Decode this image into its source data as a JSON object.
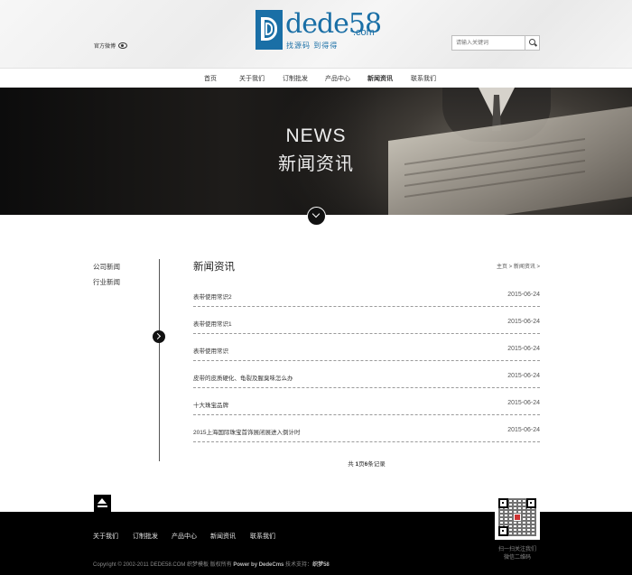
{
  "header": {
    "weibo_label": "官方微博",
    "logo": {
      "text": "dede58",
      "suffix": ".com",
      "slogan": "找源码 到得得"
    },
    "search": {
      "placeholder": "请输入关键词"
    }
  },
  "nav": {
    "items": [
      {
        "label": "首页",
        "active": false
      },
      {
        "label": "关于我们",
        "active": false
      },
      {
        "label": "订制批发",
        "active": false
      },
      {
        "label": "产品中心",
        "active": false
      },
      {
        "label": "新闻资讯",
        "active": true
      },
      {
        "label": "联系我们",
        "active": false
      }
    ]
  },
  "banner": {
    "title_en": "NEWS",
    "title_cn": "新闻资讯"
  },
  "sidebar": {
    "items": [
      "公司新闻",
      "行业新闻"
    ]
  },
  "content": {
    "title": "新闻资讯",
    "breadcrumb": {
      "home": "主页",
      "sep": " > ",
      "current": "新闻资讯",
      "tail": " >"
    },
    "news": [
      {
        "title": "表带使用常识2",
        "date": "2015-06-24"
      },
      {
        "title": "表带使用常识1",
        "date": "2015-06-24"
      },
      {
        "title": "表带使用常识",
        "date": "2015-06-24"
      },
      {
        "title": "皮带的皮质硬化、龟裂及腥臭味怎么办",
        "date": "2015-06-24"
      },
      {
        "title": "十大珠宝品牌",
        "date": "2015-06-24"
      },
      {
        "title": "2015上海国际珠宝首饰展闭展进入倒计时",
        "date": "2015-06-24"
      }
    ],
    "pagination": {
      "prefix": "共 ",
      "pages": "1",
      "mid": "页",
      "records": "6",
      "suffix": "条记录"
    }
  },
  "footer": {
    "links": [
      "关于我们",
      "订制批发",
      "产品中心",
      "新闻资讯",
      "联系我们"
    ],
    "copyright": {
      "pre": "Copyright © 2002-2011 DEDE58.COM 织梦模板 版权所有 ",
      "power": "Power by DedeCms",
      "mid": " 技术支持：",
      "support": "织梦58"
    },
    "qr_caption": [
      "扫一扫关注我们",
      "微信二维码"
    ]
  }
}
